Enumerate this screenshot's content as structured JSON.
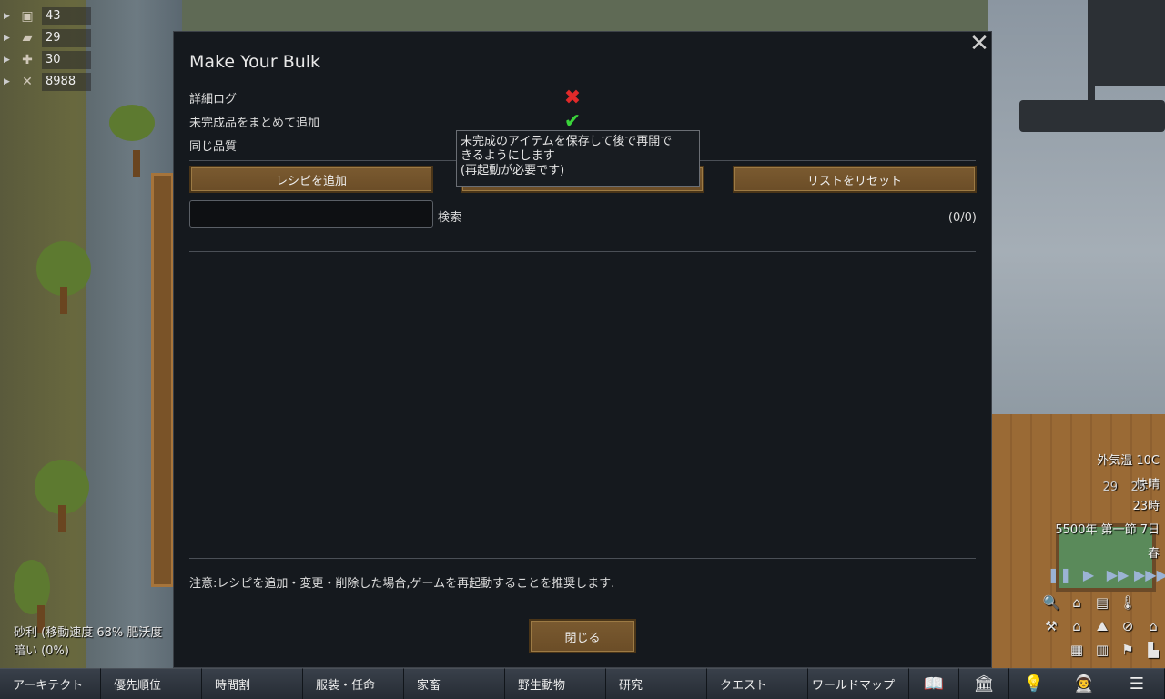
{
  "resources": [
    {
      "icon": "stone-icon",
      "glyph": "▣",
      "value": "43"
    },
    {
      "icon": "wood-icon",
      "glyph": "▰",
      "value": "29"
    },
    {
      "icon": "medicine-icon",
      "glyph": "✚",
      "value": "30"
    },
    {
      "icon": "steel-icon",
      "glyph": "✕",
      "value": "8988"
    }
  ],
  "dialog": {
    "title": "Make Your Bulk",
    "close_glyph": "✕",
    "options": [
      {
        "label": "詳細ログ",
        "state": "off",
        "glyph": "✖"
      },
      {
        "label": "未完成品をまとめて追加",
        "state": "on",
        "glyph": "✔"
      },
      {
        "label": "同じ品質"
      }
    ],
    "buttons": {
      "add_recipe": "レシピを追加",
      "middle": "",
      "reset_list": "リストをリセット"
    },
    "search": {
      "value": "",
      "label": "検索"
    },
    "count": "(0/0)",
    "note": "注意:レシピを追加・変更・削除した場合,ゲームを再起動することを推奨します.",
    "close_button": "閉じる",
    "tooltip": {
      "line1": "未完成のアイテムを保存して後で再開で",
      "line2": "きるようにします",
      "line3": "(再起動が必要です)"
    }
  },
  "hud": {
    "outdoor_temp": "外気温 10C",
    "weather": "快晴",
    "colonists": "29",
    "animals": "25",
    "time": "23時",
    "date": "5500年 第一節 7日",
    "season": "春"
  },
  "speed_controls": [
    "❚❚",
    "▶",
    "▶▶",
    "▶▶▶"
  ],
  "overlay_icons": [
    "🔍",
    "⌂",
    "▤",
    "🌡",
    "",
    "⚒",
    "⌂",
    "⛰",
    "⊘",
    "⌂",
    "",
    "▦",
    "▥",
    "⚑",
    "▙",
    "▤"
  ],
  "terrain": {
    "line1": "砂利 (移動速度 68% 肥沃度",
    "line2": "暗い (0%)"
  },
  "bottom_tabs": [
    {
      "label": "アーキテクト",
      "name": "tab-architect"
    },
    {
      "label": "優先順位",
      "name": "tab-work"
    },
    {
      "label": "時間割",
      "name": "tab-schedule"
    },
    {
      "label": "服装・任命",
      "name": "tab-assign"
    },
    {
      "label": "家畜",
      "name": "tab-animals"
    },
    {
      "label": "野生動物",
      "name": "tab-wildlife"
    },
    {
      "label": "研究",
      "name": "tab-research"
    },
    {
      "label": "クエスト",
      "name": "tab-quests"
    },
    {
      "label": "ワールドマップ",
      "name": "tab-world"
    }
  ],
  "bottom_icons": [
    {
      "glyph": "📖",
      "name": "history-icon"
    },
    {
      "glyph": "🏛",
      "name": "factions-icon"
    },
    {
      "glyph": "💡",
      "name": "ideas-icon"
    },
    {
      "glyph": "👨‍🚀",
      "name": "ideology-icon"
    },
    {
      "glyph": "☰",
      "name": "menu-icon"
    }
  ]
}
